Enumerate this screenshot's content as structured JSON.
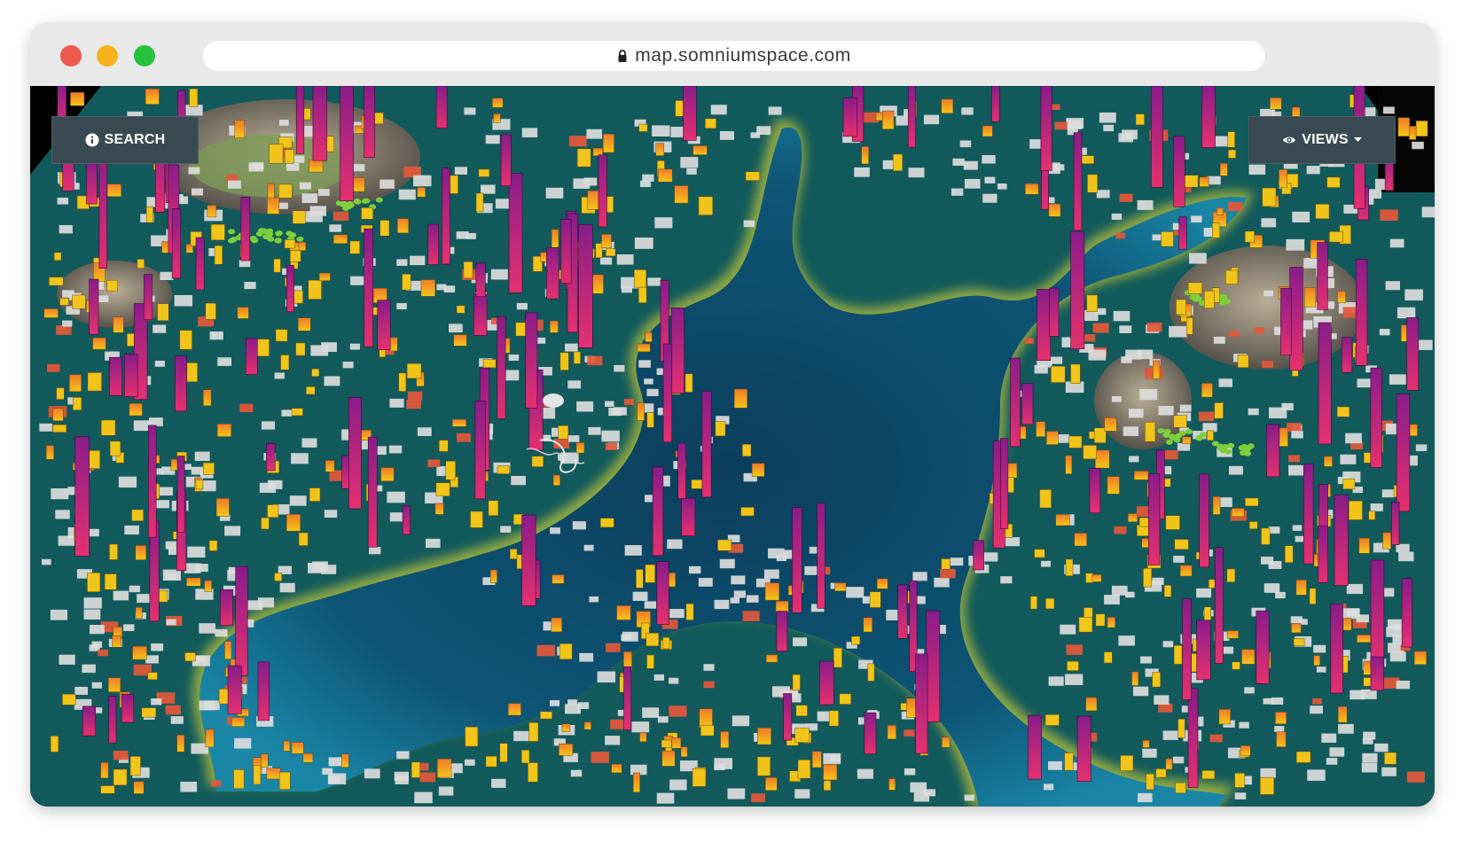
{
  "browser": {
    "url": "map.somniumspace.com"
  },
  "map": {
    "search_label": "SEARCH",
    "views_label": "VIEWS",
    "colors": {
      "water_deep": "#0d4a66",
      "water_shallow": "#13708f",
      "shore_glow": "#a7b83a",
      "land": "#12595a",
      "parcel_empty": "#dcdcdc",
      "parcel_red": "#e4583a",
      "building_yellow": "#f0c419",
      "building_orange": "#f07a2a",
      "tower_magenta": "#d6237a",
      "tower_purple": "#8a1d8a",
      "mountain": "#7b746a",
      "vegetation": "#7ccf3a"
    }
  }
}
